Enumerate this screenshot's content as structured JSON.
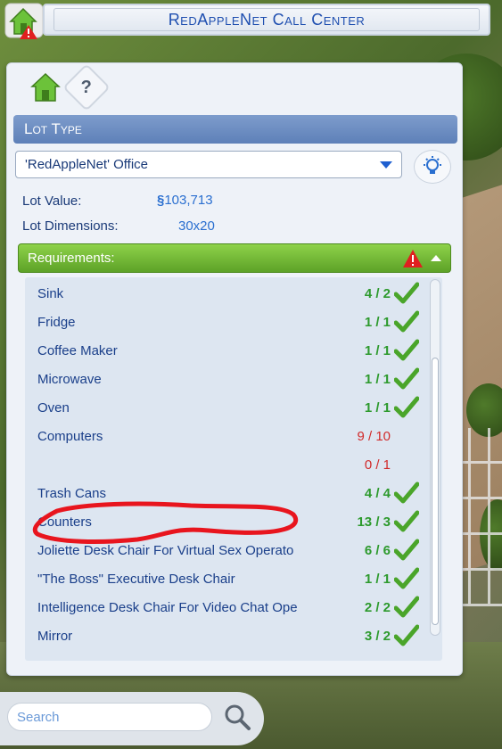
{
  "window": {
    "title": "RedAppleNet Call Center"
  },
  "panel": {
    "section_title": "Lot Type",
    "lot_type_selected": "'RedAppleNet' Office",
    "lot_value_label": "Lot Value:",
    "lot_value": "103,713",
    "currency_symbol": "§",
    "lot_dimensions_label": "Lot Dimensions:",
    "lot_dimensions": "30x20",
    "help_label": "?"
  },
  "requirements": {
    "header": "Requirements:",
    "items": [
      {
        "name": "Sink",
        "count": "4 / 2",
        "met": true
      },
      {
        "name": "Fridge",
        "count": "1 / 1",
        "met": true
      },
      {
        "name": "Coffee Maker",
        "count": "1 / 1",
        "met": true
      },
      {
        "name": "Microwave",
        "count": "1 / 1",
        "met": true
      },
      {
        "name": "Oven",
        "count": "1 / 1",
        "met": true
      },
      {
        "name": "Computers",
        "count": "9 / 10",
        "met": false
      },
      {
        "name": "",
        "count": "0 / 1",
        "met": false
      },
      {
        "name": "Trash Cans",
        "count": "4 / 4",
        "met": true
      },
      {
        "name": "Counters",
        "count": "13 / 3",
        "met": true
      },
      {
        "name": "Joliette Desk Chair For Virtual Sex Operato",
        "count": "6 / 6",
        "met": true
      },
      {
        "name": "\"The Boss\" Executive Desk Chair",
        "count": "1 / 1",
        "met": true
      },
      {
        "name": "Intelligence Desk Chair For Video Chat Ope",
        "count": "2 / 2",
        "met": true
      },
      {
        "name": "Mirror",
        "count": "3 / 2",
        "met": true
      }
    ]
  },
  "search": {
    "placeholder": "Search"
  },
  "colors": {
    "accent_blue": "#1f4fb0",
    "ok_green": "#2d9a2d",
    "bad_red": "#d12b2b",
    "req_header_green": "#6cb533",
    "section_blue": "#6a8cc2"
  }
}
